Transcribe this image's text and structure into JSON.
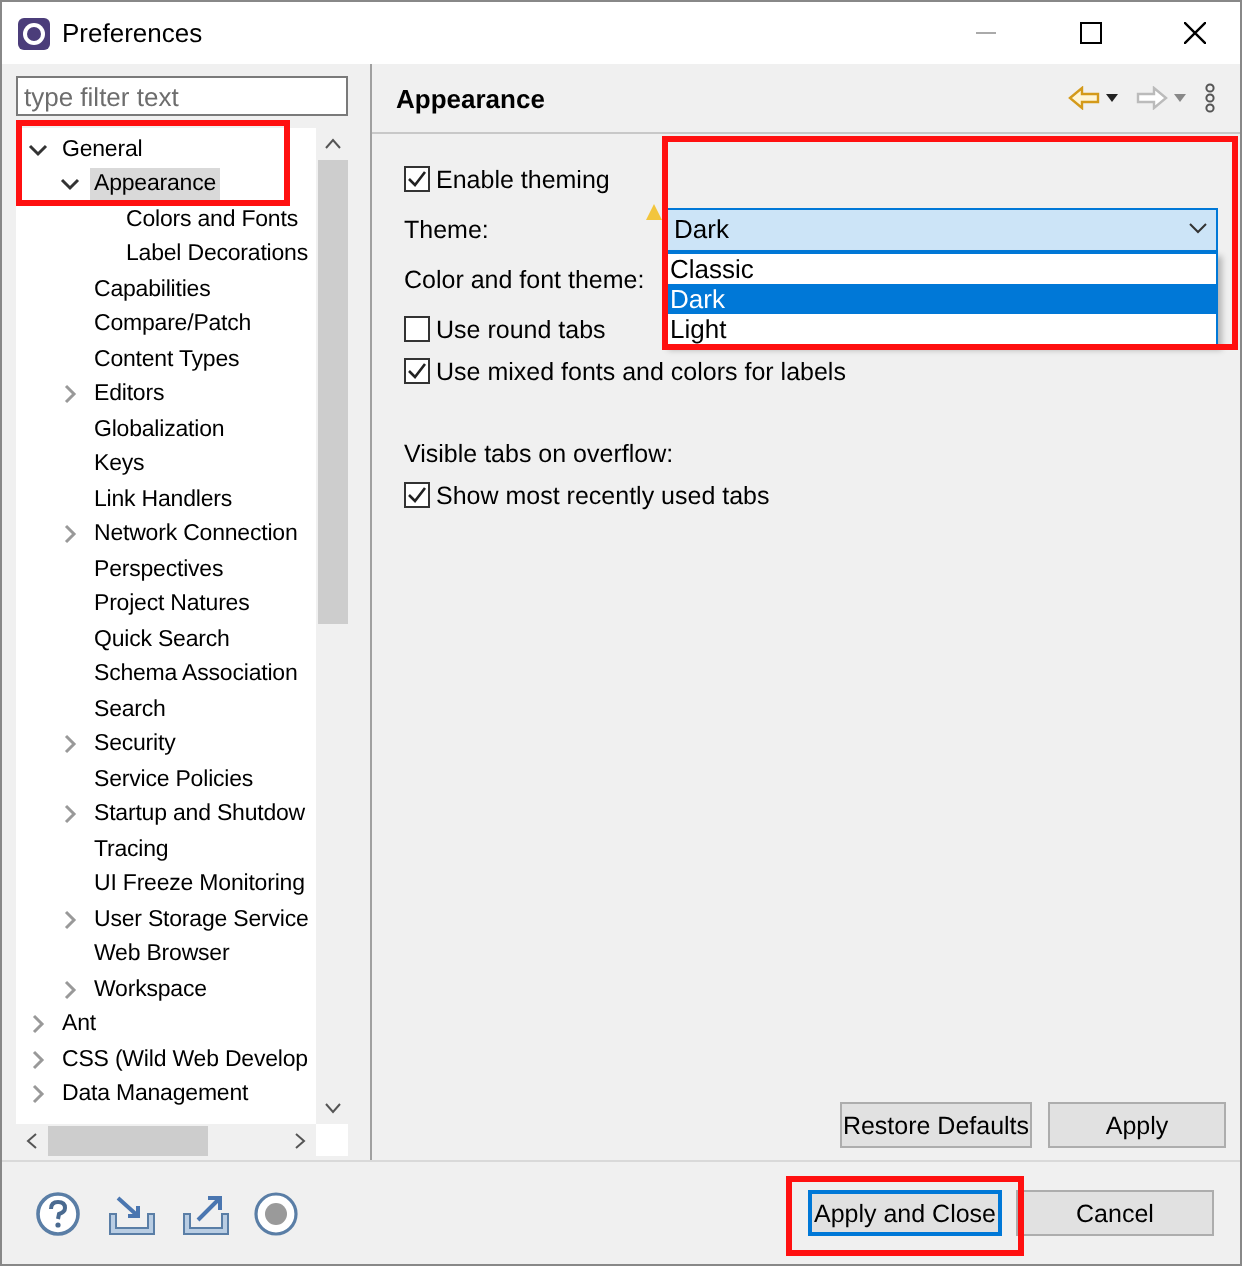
{
  "window": {
    "title": "Preferences"
  },
  "filter": {
    "placeholder": "type filter text"
  },
  "tree": [
    {
      "label": "General",
      "expanded": true,
      "selected": false,
      "children": [
        {
          "label": "Appearance",
          "expanded": true,
          "selected": true,
          "children": [
            {
              "label": "Colors and Fonts",
              "selected": false
            },
            {
              "label": "Label Decorations",
              "selected": false
            }
          ]
        },
        {
          "label": "Capabilities",
          "selected": false
        },
        {
          "label": "Compare/Patch",
          "selected": false
        },
        {
          "label": "Content Types",
          "selected": false
        },
        {
          "label": "Editors",
          "expanded": false,
          "selected": false
        },
        {
          "label": "Globalization",
          "selected": false
        },
        {
          "label": "Keys",
          "selected": false
        },
        {
          "label": "Link Handlers",
          "selected": false
        },
        {
          "label": "Network Connection",
          "expanded": false,
          "selected": false
        },
        {
          "label": "Perspectives",
          "selected": false
        },
        {
          "label": "Project Natures",
          "selected": false
        },
        {
          "label": "Quick Search",
          "selected": false
        },
        {
          "label": "Schema Association",
          "selected": false
        },
        {
          "label": "Search",
          "selected": false
        },
        {
          "label": "Security",
          "expanded": false,
          "selected": false
        },
        {
          "label": "Service Policies",
          "selected": false
        },
        {
          "label": "Startup and Shutdow",
          "expanded": false,
          "selected": false
        },
        {
          "label": "Tracing",
          "selected": false
        },
        {
          "label": "UI Freeze Monitoring",
          "selected": false
        },
        {
          "label": "User Storage Service",
          "expanded": false,
          "selected": false
        },
        {
          "label": "Web Browser",
          "selected": false
        },
        {
          "label": "Workspace",
          "expanded": false,
          "selected": false
        }
      ]
    },
    {
      "label": "Ant",
      "expanded": false,
      "selected": false
    },
    {
      "label": "CSS (Wild Web Develop",
      "expanded": false,
      "selected": false
    },
    {
      "label": "Data Management",
      "expanded": false,
      "selected": false
    }
  ],
  "page": {
    "title": "Appearance",
    "options": [
      {
        "kind": "checkbox",
        "label": "Enable theming",
        "checked": true
      },
      {
        "kind": "combo",
        "label": "Theme:",
        "value": "Dark",
        "warning": true,
        "open": true,
        "options": [
          {
            "label": "Classic",
            "selected": false
          },
          {
            "label": "Dark",
            "selected": true
          },
          {
            "label": "Light",
            "selected": false
          }
        ]
      },
      {
        "kind": "label",
        "label": "Color and font theme:"
      },
      {
        "kind": "checkbox",
        "label": "Use round tabs",
        "checked": false
      },
      {
        "kind": "checkbox",
        "label": "Use mixed fonts and colors for labels",
        "checked": true
      },
      {
        "kind": "heading",
        "label": "Visible tabs on overflow:"
      },
      {
        "kind": "checkbox",
        "label": "Show most recently used tabs",
        "checked": true
      }
    ]
  },
  "page_buttons": [
    "Restore Defaults",
    "Apply"
  ],
  "footer_buttons": [
    {
      "label": "Apply and Close",
      "default": true
    },
    {
      "label": "Cancel",
      "default": false
    }
  ]
}
